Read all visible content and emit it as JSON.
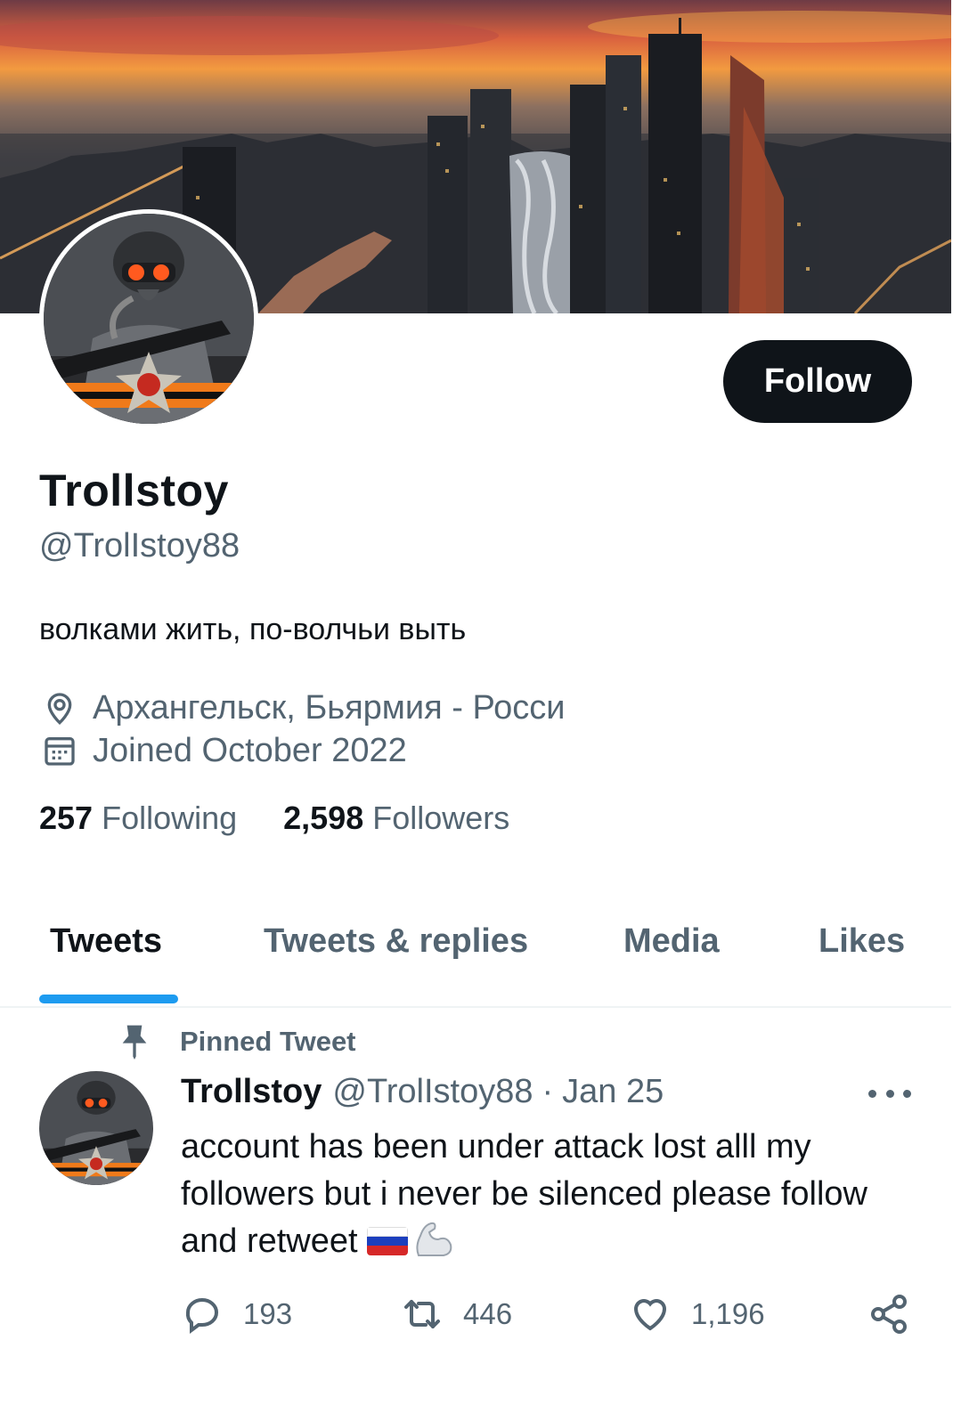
{
  "profile": {
    "display_name": "Trollstoy",
    "handle": "@TrolIstoy88",
    "bio": "волками жить, по-волчьи выть",
    "location": "Архангельск, Бьярмия - Росси",
    "joined": "Joined October 2022",
    "following_count": "257",
    "following_label": "Following",
    "followers_count": "2,598",
    "followers_label": "Followers",
    "follow_button": "Follow"
  },
  "icons": {
    "location": "map-pin-icon",
    "joined": "calendar-icon",
    "pinned": "pin-icon",
    "more": "more-horizontal-icon",
    "reply": "reply-icon",
    "retweet": "retweet-icon",
    "like": "heart-icon",
    "share": "share-icon"
  },
  "tabs": [
    {
      "label": "Tweets",
      "active": true
    },
    {
      "label": "Tweets & replies",
      "active": false
    },
    {
      "label": "Media",
      "active": false
    },
    {
      "label": "Likes",
      "active": false
    }
  ],
  "pinned_tweet": {
    "pinned_label": "Pinned Tweet",
    "author_name": "Trollstoy",
    "author_handle": "@TrolIstoy88",
    "separator": "·",
    "date": "Jan 25",
    "text": "account has been under attack lost alll my followers but i never be silenced please follow and retweet",
    "emoji": [
      "russian-flag",
      "flexed-biceps"
    ],
    "replies": "193",
    "retweets": "446",
    "likes": "1,196"
  },
  "colors": {
    "text_primary": "#0f1419",
    "text_secondary": "#536471",
    "accent": "#1d9bf0",
    "divider": "#eff3f4",
    "button_bg": "#0f1419"
  }
}
